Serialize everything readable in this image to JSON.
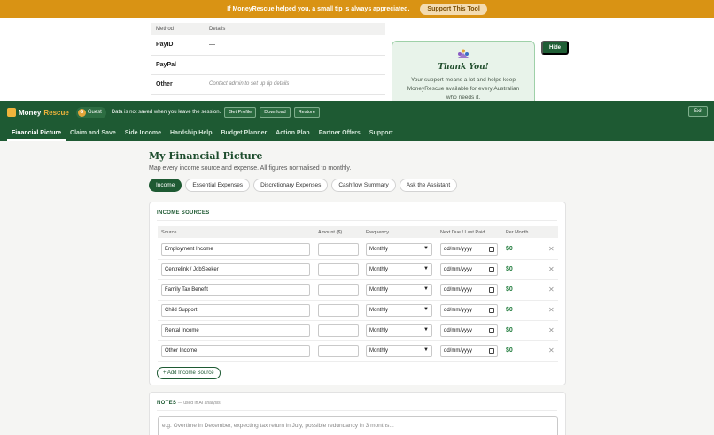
{
  "tipbar": {
    "message": "If MoneyRescue helped you, a small tip is always appreciated.",
    "button": "Support This Tool"
  },
  "tip_table": {
    "headers": [
      "Method",
      "Details"
    ],
    "rows": [
      {
        "method": "PayID",
        "details": "—"
      },
      {
        "method": "PayPal",
        "details": "—"
      },
      {
        "method": "Other",
        "details": "Contact admin to set up tip details"
      }
    ]
  },
  "thanks": {
    "title": "Thank You!",
    "text": "Your support means a lot and helps keep MoneyRescue available for every Australian who needs it."
  },
  "hide_button": "Hide",
  "header": {
    "brand_main": "Money",
    "brand_accent": "Rescue",
    "guest_initial": "G",
    "guest_label": "Guest",
    "session_note": "Data is not saved when you leave the session.",
    "buttons": [
      "Get Profile",
      "Download",
      "Restore"
    ],
    "exit": "Exit"
  },
  "nav": [
    "Financial Picture",
    "Claim and Save",
    "Side Income",
    "Hardship Help",
    "Budget Planner",
    "Action Plan",
    "Partner Offers",
    "Support"
  ],
  "page": {
    "title": "My Financial Picture",
    "subtitle": "Map every income source and expense. All figures normalised to monthly."
  },
  "tabs": [
    "Income",
    "Essential Expenses",
    "Discretionary Expenses",
    "Cashflow Summary",
    "Ask the Assistant"
  ],
  "income": {
    "heading": "INCOME SOURCES",
    "columns": [
      "Source",
      "Amount ($)",
      "Frequency",
      "Next Due / Last Paid",
      "Per Month"
    ],
    "rows": [
      {
        "source": "Employment Income",
        "frequency": "Monthly",
        "date": "dd/mm/yyyy",
        "per_month": "$0"
      },
      {
        "source": "Centrelink / JobSeeker",
        "frequency": "Monthly",
        "date": "dd/mm/yyyy",
        "per_month": "$0"
      },
      {
        "source": "Family Tax Benefit",
        "frequency": "Monthly",
        "date": "dd/mm/yyyy",
        "per_month": "$0"
      },
      {
        "source": "Child Support",
        "frequency": "Monthly",
        "date": "dd/mm/yyyy",
        "per_month": "$0"
      },
      {
        "source": "Rental Income",
        "frequency": "Monthly",
        "date": "dd/mm/yyyy",
        "per_month": "$0"
      },
      {
        "source": "Other Income",
        "frequency": "Monthly",
        "date": "dd/mm/yyyy",
        "per_month": "$0"
      }
    ],
    "add_button": "+ Add Income Source"
  },
  "notes": {
    "heading": "NOTES",
    "subnote": "— used in AI analysis",
    "placeholder": "e.g. Overtime in December, expecting tax return in July, possible redundancy in 3 months..."
  },
  "colors": {
    "brand_green": "#1e5a33",
    "tip_orange": "#d99314",
    "accent_gold": "#f0b43c"
  }
}
